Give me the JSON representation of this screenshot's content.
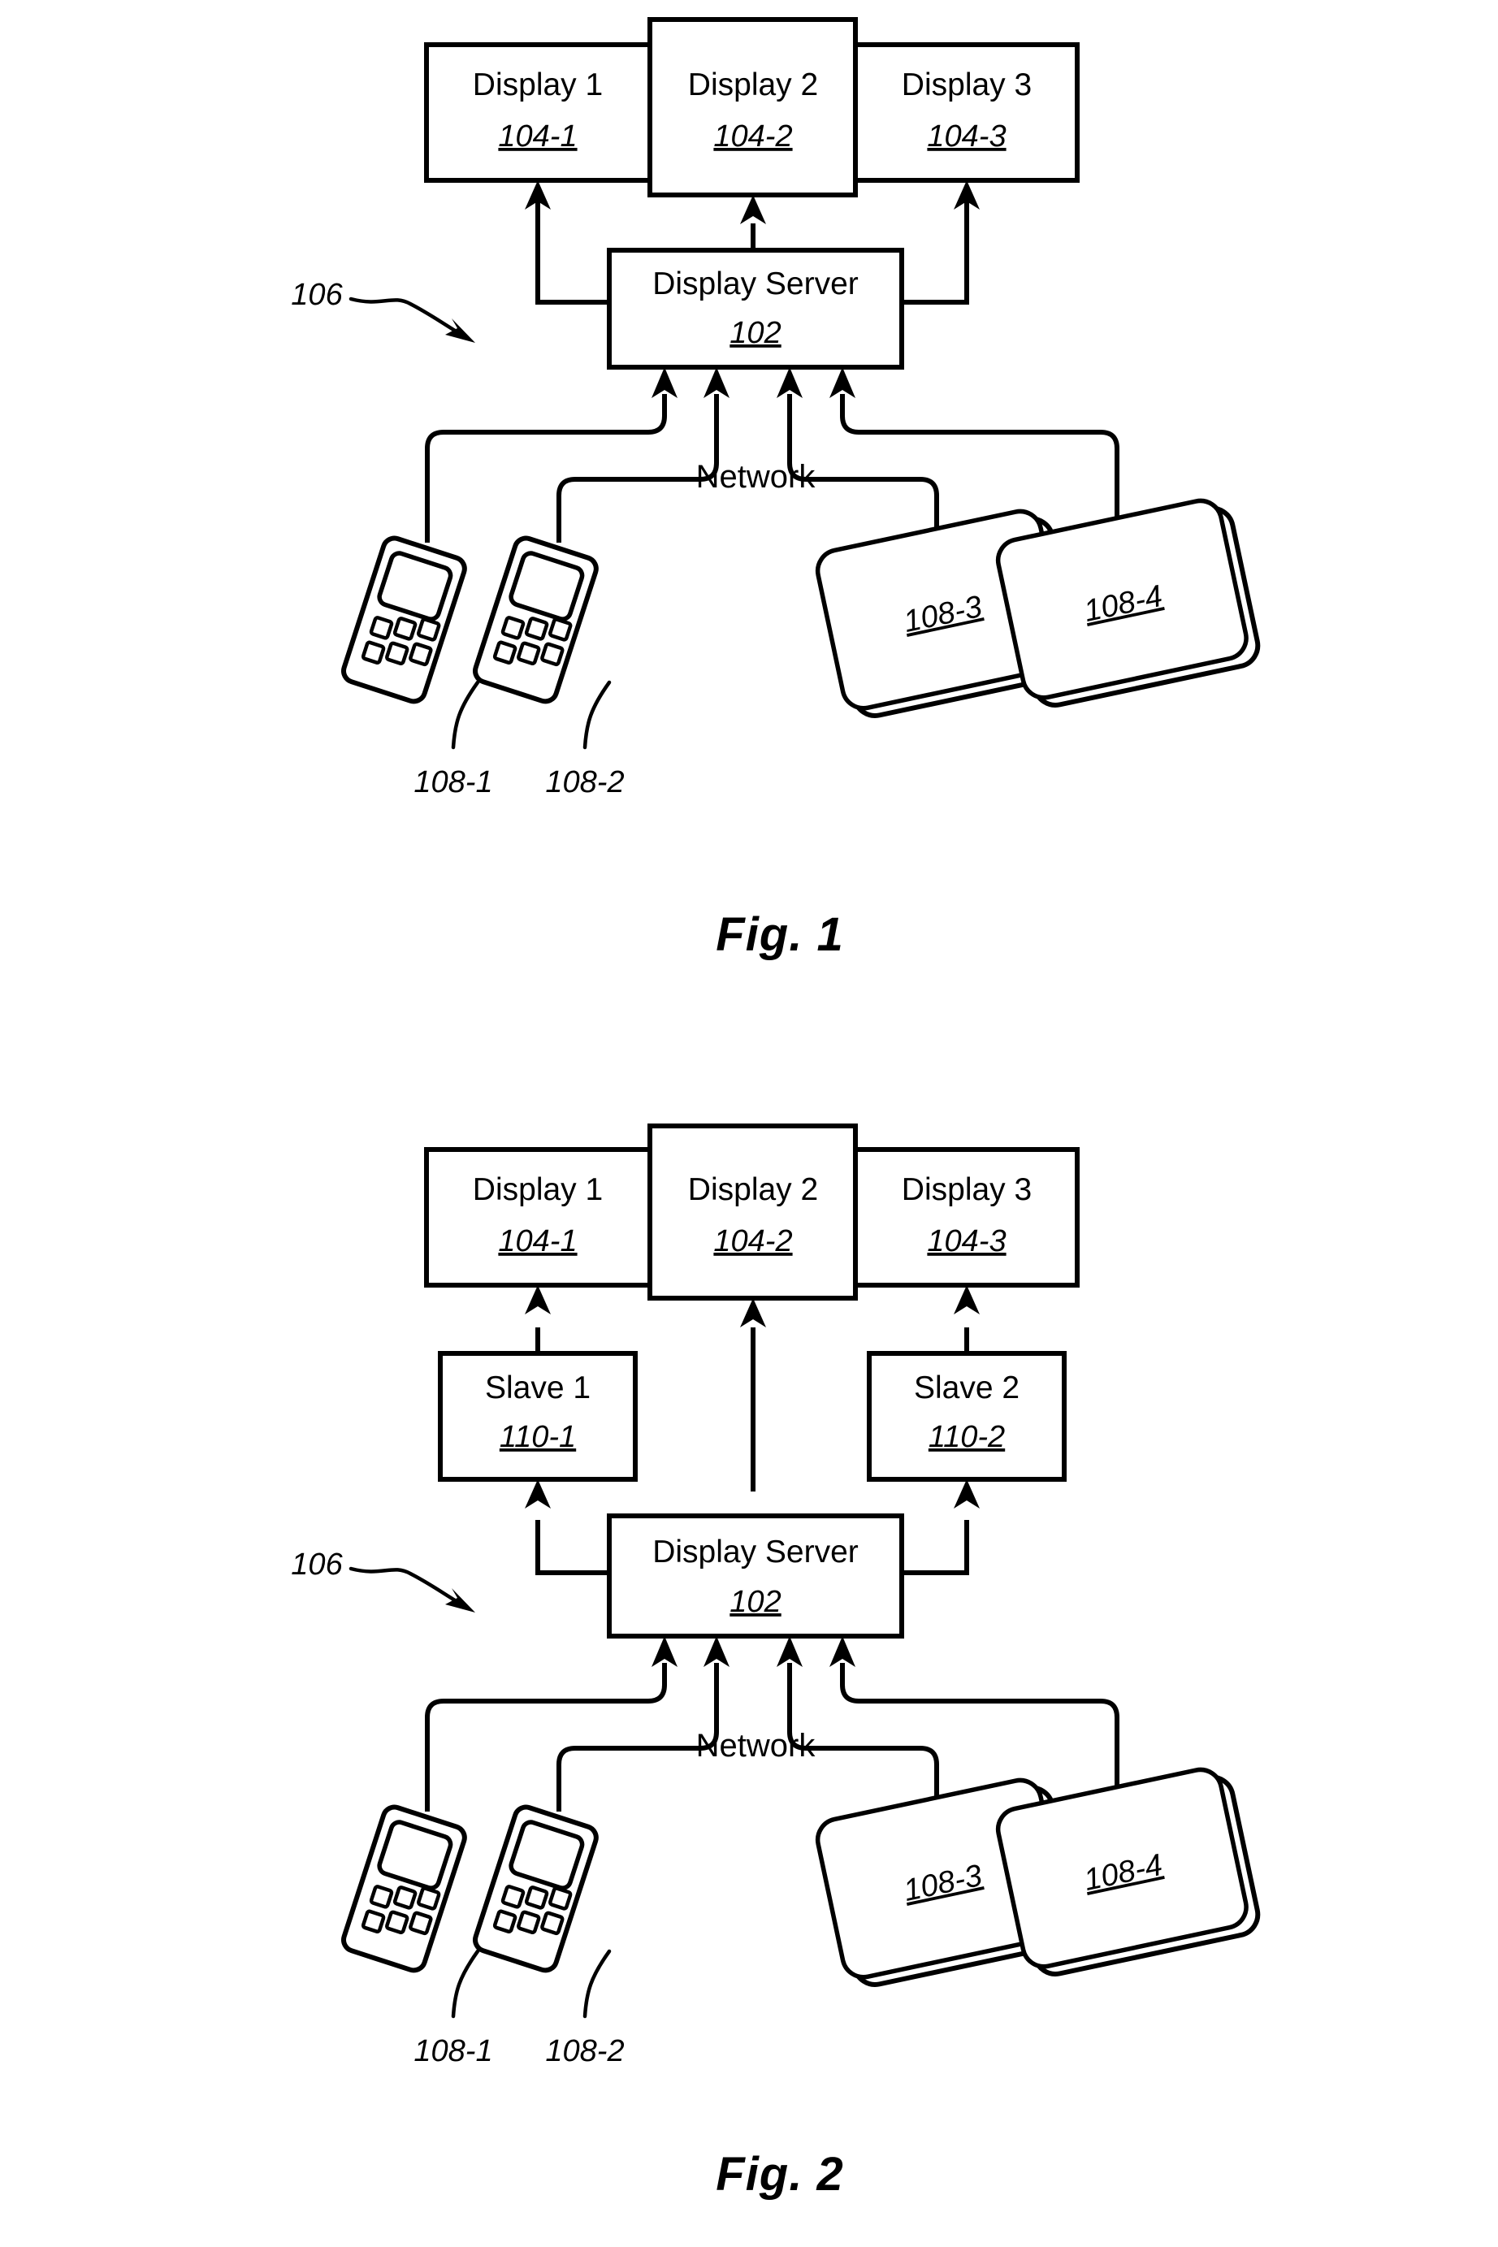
{
  "document": {
    "type": "patent-figure-sheet",
    "background_color": "#ffffff",
    "line_color": "#000000"
  },
  "figures": [
    {
      "id": "fig1",
      "caption": "Fig. 1",
      "system_reference": "106",
      "network_label": "Network",
      "displays": [
        {
          "label": "Display 1",
          "number": "104-1"
        },
        {
          "label": "Display 2",
          "number": "104-2"
        },
        {
          "label": "Display 3",
          "number": "104-3"
        }
      ],
      "server": {
        "label": "Display Server",
        "number": "102"
      },
      "slaves": [],
      "devices": [
        {
          "kind": "phone",
          "number": "108-1",
          "label_underlined": false
        },
        {
          "kind": "phone",
          "number": "108-2",
          "label_underlined": false
        },
        {
          "kind": "tablet",
          "number": "108-3",
          "label_underlined": true
        },
        {
          "kind": "tablet",
          "number": "108-4",
          "label_underlined": true
        }
      ]
    },
    {
      "id": "fig2",
      "caption": "Fig. 2",
      "system_reference": "106",
      "network_label": "Network",
      "displays": [
        {
          "label": "Display 1",
          "number": "104-1"
        },
        {
          "label": "Display 2",
          "number": "104-2"
        },
        {
          "label": "Display 3",
          "number": "104-3"
        }
      ],
      "server": {
        "label": "Display Server",
        "number": "102"
      },
      "slaves": [
        {
          "label": "Slave 1",
          "number": "110-1"
        },
        {
          "label": "Slave 2",
          "number": "110-2"
        }
      ],
      "devices": [
        {
          "kind": "phone",
          "number": "108-1",
          "label_underlined": false
        },
        {
          "kind": "phone",
          "number": "108-2",
          "label_underlined": false
        },
        {
          "kind": "tablet",
          "number": "108-3",
          "label_underlined": true
        },
        {
          "kind": "tablet",
          "number": "108-4",
          "label_underlined": true
        }
      ]
    }
  ]
}
